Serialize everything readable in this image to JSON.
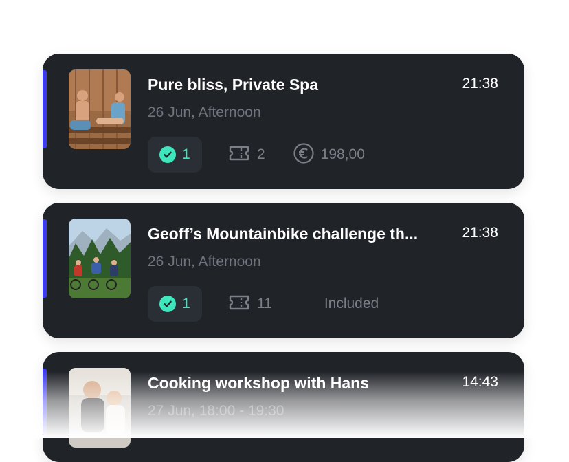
{
  "cards": [
    {
      "title": "Pure bliss, Private Spa",
      "time": "21:38",
      "subtitle": "26 Jun, Afternoon",
      "checked_count": "1",
      "ticket_count": "2",
      "price": "198,00",
      "thumb_icon": "spa-photo"
    },
    {
      "title": "Geoff’s Mountainbike challenge th...",
      "time": "21:38",
      "subtitle": "26 Jun, Afternoon",
      "checked_count": "1",
      "ticket_count": "11",
      "price_label": "Included",
      "thumb_icon": "mountainbike-photo"
    },
    {
      "title": "Cooking workshop with Hans",
      "time": "14:43",
      "subtitle": "27 Jun, 18:00 - 19:30",
      "thumb_icon": "cooking-photo"
    }
  ],
  "colors": {
    "card_bg": "#202328",
    "accent": "#3b3cf0",
    "check_green": "#3ee6bd",
    "muted_text": "#6f747d"
  }
}
